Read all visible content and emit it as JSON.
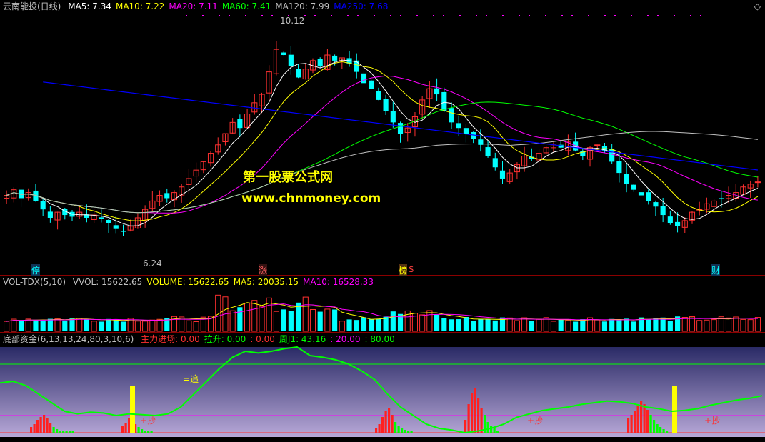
{
  "main": {
    "title": "云南能投(日线)",
    "ma": [
      {
        "label": "MA5: 7.34",
        "color": "#ffffff"
      },
      {
        "label": "MA10: 7.22",
        "color": "#ffff00"
      },
      {
        "label": "MA20: 7.11",
        "color": "#ff00ff"
      },
      {
        "label": "MA60: 7.41",
        "color": "#00ff00"
      },
      {
        "label": "MA120: 7.99",
        "color": "#c0c0c0"
      },
      {
        "label": "MA250: 7.68",
        "color": "#0000ff"
      }
    ],
    "high_label": "10.12",
    "low_label": "6.24",
    "tags": [
      {
        "text": "停",
        "color": "#00ffff"
      },
      {
        "text": "涨",
        "color": "#ff6060"
      },
      {
        "text": "榜",
        "color": "#ffff00"
      },
      {
        "text": "$",
        "color": "#ff4040"
      },
      {
        "text": "财",
        "color": "#00ffff"
      }
    ],
    "watermark_cn": "第一股票公式网",
    "watermark_url": "www.chnmoney.com"
  },
  "vol": {
    "title": "VOL-TDX(5,10)",
    "items": [
      {
        "label": "VVOL: 15622.65",
        "color": "#c0c0c0"
      },
      {
        "label": "VOLUME: 15622.65",
        "color": "#ffff00"
      },
      {
        "label": "MA5: 20035.15",
        "color": "#ffff00"
      },
      {
        "label": "MA10: 16528.33",
        "color": "#ff00ff"
      }
    ]
  },
  "ind": {
    "title": "底部资金(6,13,13,24,80,3,10,6)",
    "items": [
      {
        "label": "主力进场: 0.00",
        "color": "#ff3030"
      },
      {
        "label": "拉升: 0.00",
        "color": "#00ff00"
      },
      {
        "label": ": 0.00",
        "color": "#ff3030"
      },
      {
        "label": "周J1: 43.16",
        "color": "#00ff00"
      },
      {
        "label": ": 20.00",
        "color": "#ff00ff"
      },
      {
        "label": ": 80.00",
        "color": "#00ff00"
      }
    ],
    "chase_label": "=追",
    "buy_label": "+抄"
  },
  "chart_data": {
    "type": "candlestick",
    "price_range": [
      6.0,
      10.3
    ],
    "candles": [
      7.1,
      7.2,
      7.05,
      7.15,
      7.0,
      6.85,
      6.7,
      6.8,
      6.75,
      6.72,
      6.8,
      6.7,
      6.75,
      6.68,
      6.6,
      6.5,
      6.45,
      6.55,
      6.7,
      6.85,
      7.0,
      7.1,
      7.05,
      7.15,
      7.25,
      7.4,
      7.55,
      7.7,
      7.85,
      8.0,
      8.2,
      8.4,
      8.3,
      8.55,
      8.75,
      8.9,
      9.3,
      9.7,
      9.6,
      9.4,
      9.2,
      9.35,
      9.5,
      9.4,
      9.6,
      9.5,
      9.55,
      9.45,
      9.3,
      9.1,
      9.0,
      8.8,
      8.6,
      8.4,
      8.2,
      8.3,
      8.5,
      8.8,
      9.0,
      8.9,
      8.6,
      8.4,
      8.3,
      8.2,
      8.1,
      8.0,
      7.8,
      7.6,
      7.4,
      7.5,
      7.65,
      7.8,
      7.75,
      7.85,
      7.95,
      8.0,
      7.95,
      8.05,
      7.9,
      7.8,
      7.95,
      8.0,
      7.9,
      7.7,
      7.5,
      7.3,
      7.2,
      7.1,
      7.0,
      6.9,
      6.75,
      6.6,
      6.55,
      6.65,
      6.8,
      6.85,
      6.95,
      7.0,
      7.05,
      7.1,
      7.15,
      7.25,
      7.3,
      7.34
    ],
    "volume_range": [
      0,
      40000
    ],
    "indicator_range": [
      -5,
      100
    ],
    "indicator_levels": [
      20,
      80
    ],
    "week_j1": [
      58,
      60,
      55,
      45,
      35,
      25,
      22,
      24,
      23,
      20,
      22,
      21,
      20,
      22,
      30,
      45,
      60,
      75,
      88,
      95,
      93,
      95,
      98,
      100,
      90,
      88,
      85,
      80,
      72,
      62,
      45,
      30,
      20,
      10,
      5,
      3,
      0,
      2,
      5,
      10,
      18,
      22,
      26,
      28,
      30,
      33,
      35,
      37,
      36,
      34,
      30,
      28,
      25,
      26,
      28,
      32,
      35,
      38,
      40,
      43.16
    ]
  }
}
